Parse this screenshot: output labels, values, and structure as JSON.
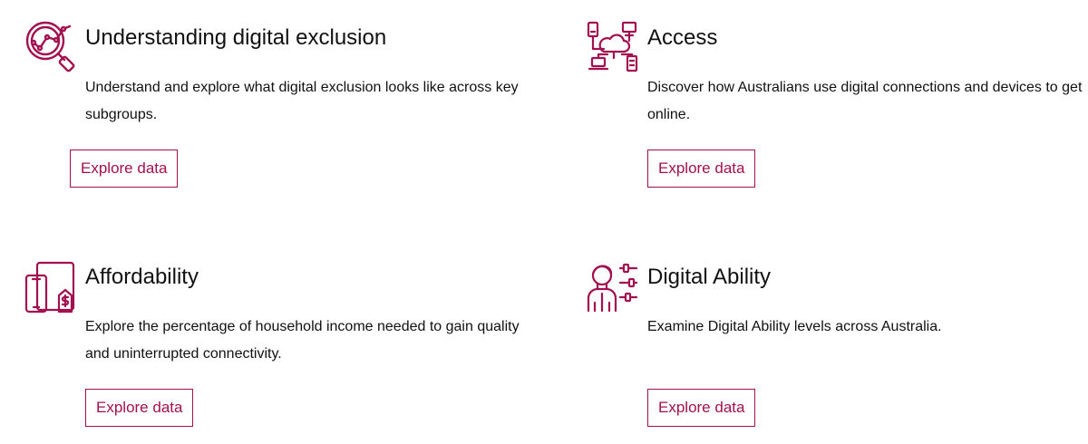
{
  "theme": {
    "accent": "#a3104f",
    "text": "#111111",
    "background": "#ffffff"
  },
  "cards": [
    {
      "icon": "magnifier-chart-icon",
      "title": "Understanding digital exclusion",
      "description": "Understand and explore what digital exclusion looks like across key subgroups.",
      "button_label": "Explore data"
    },
    {
      "icon": "network-devices-icon",
      "title": "Access",
      "description": "Discover how Australians use digital connections and devices to get online.",
      "button_label": "Explore data"
    },
    {
      "icon": "devices-dollar-icon",
      "title": "Affordability",
      "description": "Explore the percentage of household income needed to gain quality and uninterrupted connectivity.",
      "button_label": "Explore data"
    },
    {
      "icon": "person-sliders-icon",
      "title": "Digital Ability",
      "description": "Examine Digital Ability levels across Australia.",
      "button_label": "Explore data"
    }
  ]
}
